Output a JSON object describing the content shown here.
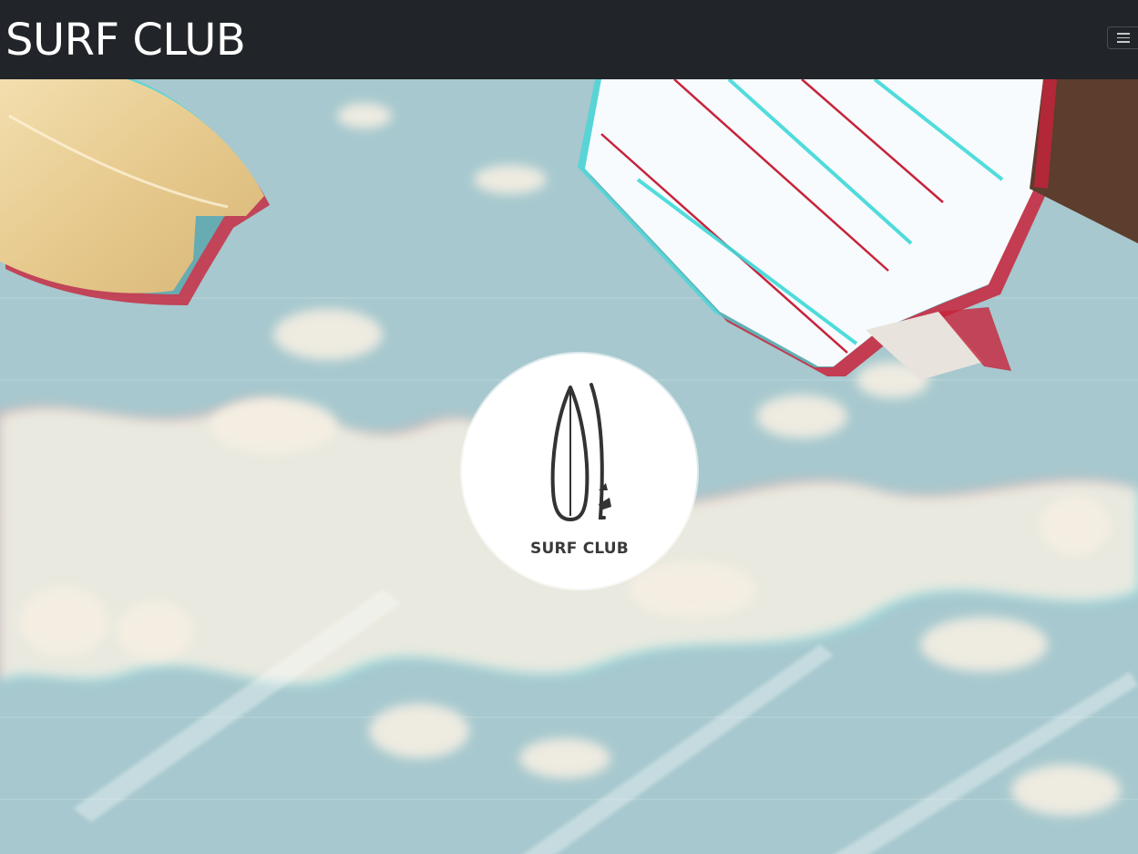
{
  "navbar": {
    "brand": "SURF CLUB",
    "toggler_icon": "hamburger-menu-icon"
  },
  "hero": {
    "logo": {
      "icon": "surfboard-logo-icon",
      "text": "SURF CLUB"
    }
  },
  "colors": {
    "navbar_bg": "#212529",
    "water": "#a7c9cf",
    "foam": "#f4ecdf",
    "wood_board": "#e8cf98",
    "striped_board": "#ffffff",
    "stripe_red": "#c8233b",
    "stripe_cyan": "#3fd8d8"
  }
}
